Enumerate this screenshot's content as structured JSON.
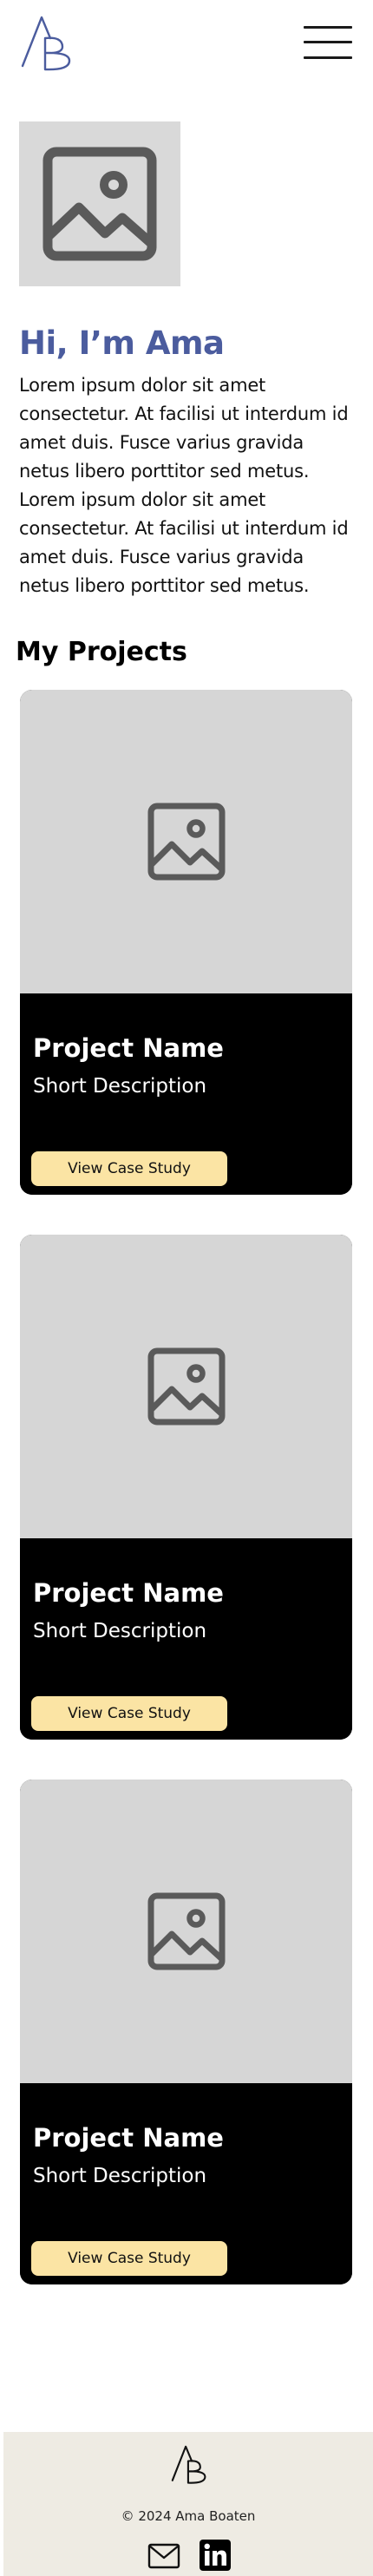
{
  "header": {
    "logo_icon": "ab-monogram-logo",
    "menu_icon": "hamburger-menu-icon"
  },
  "hero": {
    "image_icon": "image-placeholder-icon",
    "title": "Hi, I’m Ama",
    "bio": "Lorem ipsum dolor sit amet consectetur. At facilisi ut interdum id amet duis. Fusce varius gravida netus libero porttitor sed metus. Lorem ipsum dolor sit amet consectetur. At facilisi ut interdum id amet duis. Fusce varius gravida netus libero porttitor sed metus."
  },
  "projects": {
    "section_title": "My Projects",
    "items": [
      {
        "name": "Project Name",
        "description": "Short Description",
        "button_label": "View Case Study"
      },
      {
        "name": "Project Name",
        "description": "Short Description",
        "button_label": "View Case Study"
      },
      {
        "name": "Project Name",
        "description": "Short Description",
        "button_label": "View Case Study"
      }
    ]
  },
  "footer": {
    "copyright": "© 2024 Ama Boaten",
    "icons": [
      "ab-monogram-logo",
      "mail-icon",
      "linkedin-icon"
    ]
  },
  "colors": {
    "accent_blue": "#4b5c9e",
    "button_yellow": "#fbe4a4",
    "placeholder_gray": "#d9d9d9",
    "footer_bg": "#eeebe3"
  }
}
